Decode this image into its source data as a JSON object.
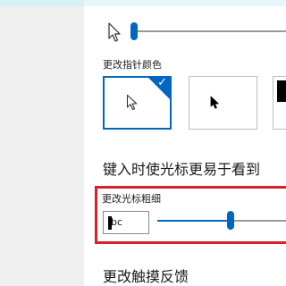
{
  "colors": {
    "accent": "#0067c0",
    "highlight": "#d8202c",
    "nav_background": "#efefef",
    "top_edge": "#e7f6fa"
  },
  "cursor_size": {
    "icon": "pointer-arrow-icon",
    "value_fraction": 0.02
  },
  "pointer_color": {
    "label": "更改指针颜色",
    "options": [
      {
        "name": "white",
        "icon": "white-pointer-icon",
        "selected": true
      },
      {
        "name": "black",
        "icon": "black-pointer-icon",
        "selected": false
      },
      {
        "name": "custom",
        "icon": "custom-color-icon",
        "selected": false
      }
    ],
    "selected_icon": "checkmark-icon"
  },
  "text_cursor": {
    "section_title": "键入时使光标更易于看到",
    "thickness_label": "更改光标粗细",
    "preview_text": "bc",
    "thickness_value_fraction": 0.53
  },
  "next_section": {
    "title": "更改触摸反馈"
  }
}
